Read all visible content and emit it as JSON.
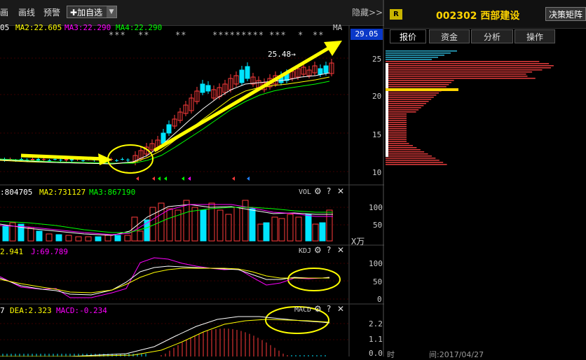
{
  "toolbar": {
    "item_partial": "画",
    "draw_line": "画线",
    "alert": "预警",
    "add_watch": "加自选",
    "hide": "隐藏>>"
  },
  "ma_legend": {
    "ma1_partial": "05",
    "ma2": "MA2:22.605",
    "ma3": "MA3:22.290",
    "ma4": "MA4:22.290",
    "ma_label": "MA",
    "stars": [
      "***",
      "**",
      "**",
      "*********",
      "***",
      "*",
      "**"
    ]
  },
  "main_chart": {
    "current_price": "29.05",
    "peak_label": "25.48→",
    "y_ticks": [
      "25",
      "20",
      "15",
      "10"
    ]
  },
  "volume_panel": {
    "ma1_partial": ":804705",
    "ma2": "MA2:731127",
    "ma3": "MA3:867190",
    "name": "VOL",
    "y_ticks": [
      "100",
      "50"
    ],
    "unit": "X万"
  },
  "kdj_panel": {
    "d_partial": "2.941",
    "j": "J:69.789",
    "name": "KDJ",
    "y_ticks": [
      "100",
      "50",
      "0"
    ]
  },
  "macd_panel": {
    "dif_partial": "7",
    "dea": "DEA:2.323",
    "macd": "MACD:-0.234",
    "name": "MACD",
    "y_ticks": [
      "2.2",
      "1.1",
      "0.0"
    ]
  },
  "right_panel": {
    "badge": "R",
    "stock_code": "002302",
    "stock_name": "西部建设",
    "decision_button": "决策矩阵",
    "tabs": [
      "报价",
      "资金",
      "分析",
      "操作"
    ],
    "y_ticks": [
      "25",
      "20",
      "15",
      "10"
    ],
    "footer_time": "时",
    "footer_date": "间:2017/04/27"
  },
  "colors": {
    "up": "#ff3b3b",
    "down": "#00e5ff",
    "ma_white": "#ffffff",
    "ma_yellow": "#ffff00",
    "ma_magenta": "#ff00ff",
    "ma_green": "#00ff00",
    "highlight_yellow": "#ffff00",
    "price_box": "#0a38c8"
  }
}
